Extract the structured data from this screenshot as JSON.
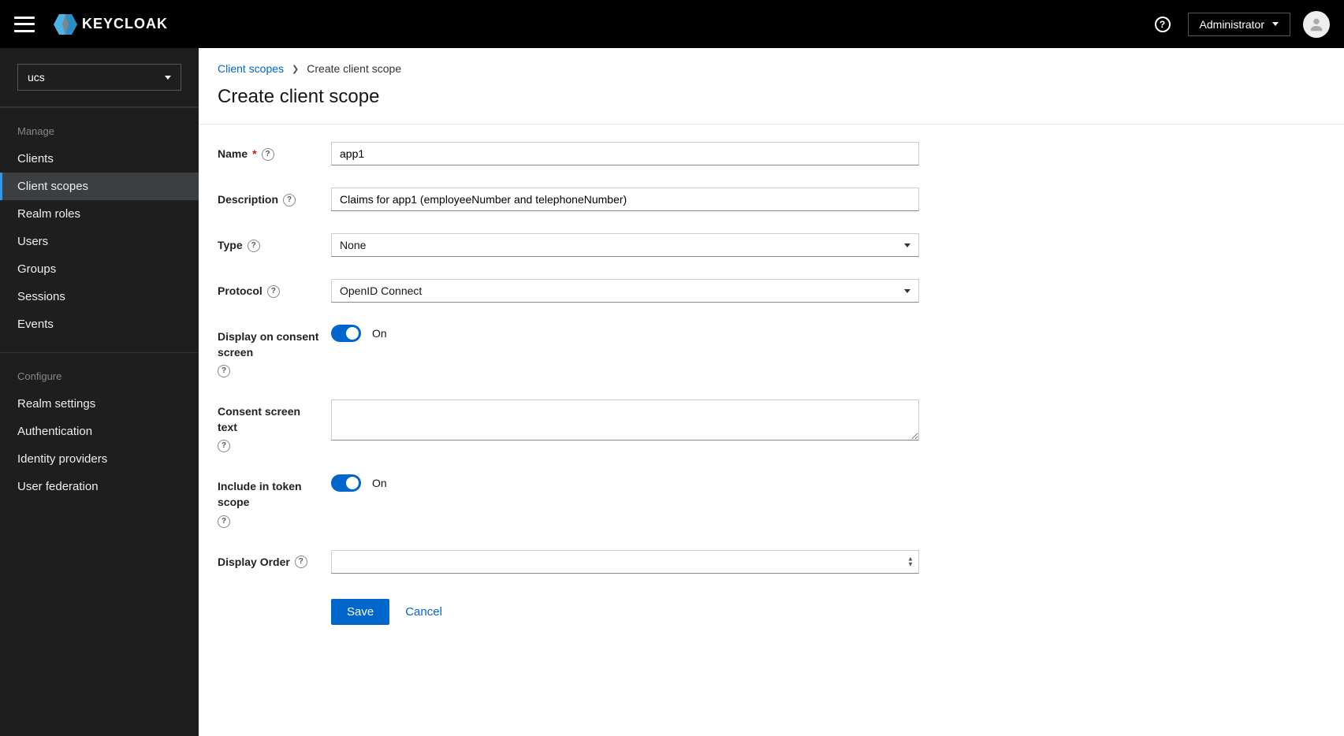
{
  "header": {
    "brand": "KEYCLOAK",
    "user_label": "Administrator"
  },
  "sidebar": {
    "realm": "ucs",
    "section_manage": "Manage",
    "section_configure": "Configure",
    "manage_items": [
      {
        "label": "Clients",
        "active": false,
        "name": "sidebar-item-clients"
      },
      {
        "label": "Client scopes",
        "active": true,
        "name": "sidebar-item-client-scopes"
      },
      {
        "label": "Realm roles",
        "active": false,
        "name": "sidebar-item-realm-roles"
      },
      {
        "label": "Users",
        "active": false,
        "name": "sidebar-item-users"
      },
      {
        "label": "Groups",
        "active": false,
        "name": "sidebar-item-groups"
      },
      {
        "label": "Sessions",
        "active": false,
        "name": "sidebar-item-sessions"
      },
      {
        "label": "Events",
        "active": false,
        "name": "sidebar-item-events"
      }
    ],
    "configure_items": [
      {
        "label": "Realm settings",
        "name": "sidebar-item-realm-settings"
      },
      {
        "label": "Authentication",
        "name": "sidebar-item-authentication"
      },
      {
        "label": "Identity providers",
        "name": "sidebar-item-identity-providers"
      },
      {
        "label": "User federation",
        "name": "sidebar-item-user-federation"
      }
    ]
  },
  "breadcrumb": {
    "parent": "Client scopes",
    "current": "Create client scope"
  },
  "page": {
    "title": "Create client scope"
  },
  "form": {
    "name": {
      "label": "Name",
      "value": "app1"
    },
    "description": {
      "label": "Description",
      "value": "Claims for app1 (employeeNumber and telephoneNumber)"
    },
    "type": {
      "label": "Type",
      "value": "None"
    },
    "protocol": {
      "label": "Protocol",
      "value": "OpenID Connect"
    },
    "display_on_consent": {
      "label": "Display on consent screen",
      "state_label": "On"
    },
    "consent_text": {
      "label": "Consent screen text",
      "value": ""
    },
    "include_in_token": {
      "label": "Include in token scope",
      "state_label": "On"
    },
    "display_order": {
      "label": "Display Order",
      "value": ""
    },
    "save": "Save",
    "cancel": "Cancel"
  }
}
